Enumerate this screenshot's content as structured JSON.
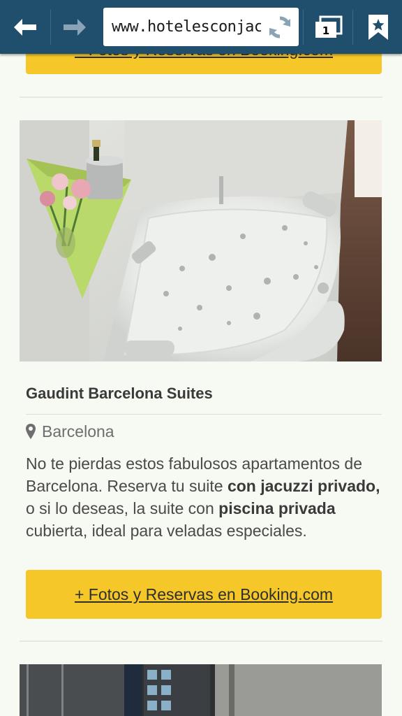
{
  "browser": {
    "url": "www.hotelesconjacuzzi.es",
    "tab_count": "1",
    "icons": {
      "back": "back-arrow-icon",
      "forward": "forward-arrow-icon",
      "reload": "reload-icon",
      "tabs": "tabs-icon",
      "bookmark": "bookmark-icon"
    }
  },
  "listing": {
    "prev_booking_label": "+ Fotos y Reservas en Booking.com",
    "hotel_name": "Gaudint Barcelona Suites",
    "city": "Barcelona",
    "description": {
      "part1": "No te pierdas estos fabulosos apartamentos de Barcelona. Reserva tu suite ",
      "bold1": "con jacuzzi privado,",
      "part2": " o si lo deseas, la suite con ",
      "bold2": "piscina privada",
      "part3": " cubierta, ideal para veladas especiales."
    },
    "booking_label": "+ Fotos y Reservas en Booking.com"
  },
  "colors": {
    "toolbar": "#1f4f6d",
    "booking_button": "#f5c728",
    "page_background": "#f7f9f3"
  }
}
